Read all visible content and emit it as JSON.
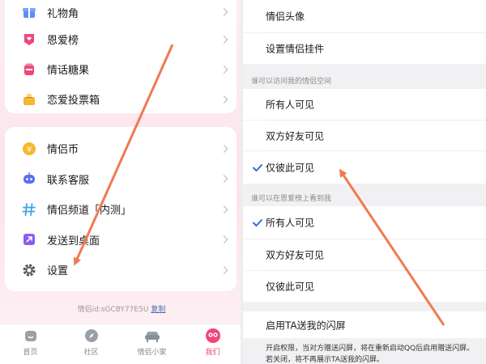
{
  "left": {
    "group1": [
      {
        "label": "礼物角",
        "icon": "gift-icon",
        "color": "#5b8ef0"
      },
      {
        "label": "恩爱榜",
        "icon": "ranking-badge-icon",
        "color": "#f0477a"
      },
      {
        "label": "情话糖果",
        "icon": "candy-jar-icon",
        "color": "#f0477a"
      },
      {
        "label": "恋爱投票箱",
        "icon": "ballot-box-icon",
        "color": "#f5b82e"
      }
    ],
    "group2": [
      {
        "label": "情侣币",
        "icon": "yen-coin-icon",
        "color": "#f5b82e"
      },
      {
        "label": "联系客服",
        "icon": "robot-service-icon",
        "color": "#5b6df0"
      },
      {
        "label": "情侣频道「内测」",
        "icon": "hashtag-icon",
        "color": "#3fa4e6"
      },
      {
        "label": "发送到桌面",
        "icon": "send-to-desktop-icon",
        "color": "#8b5cf0"
      },
      {
        "label": "设置",
        "icon": "gear-icon",
        "color": "#555555"
      }
    ],
    "uid_text": "情侣id:sGCBY77E5U",
    "copy_label": "复制",
    "tabs": [
      {
        "label": "首页",
        "icon": "home-icon"
      },
      {
        "label": "社区",
        "icon": "compass-icon"
      },
      {
        "label": "情侣小家",
        "icon": "sofa-icon"
      },
      {
        "label": "我们",
        "icon": "couple-avatar-icon",
        "active": true
      }
    ],
    "accent": "#f0477a"
  },
  "right": {
    "top_items": [
      "情侣头像",
      "设置情侣挂件"
    ],
    "section1_title": "谁可以访问我的情侣空间",
    "section1_options": [
      {
        "label": "所有人可见",
        "checked": false
      },
      {
        "label": "双方好友可见",
        "checked": false
      },
      {
        "label": "仅彼此可见",
        "checked": true
      }
    ],
    "section2_title": "谁可以在恩爱榜上看到我",
    "section2_options": [
      {
        "label": "所有人可见",
        "checked": true
      },
      {
        "label": "双方好友可见",
        "checked": false
      },
      {
        "label": "仅彼此可见",
        "checked": false
      }
    ],
    "flash_label": "启用TA送我的闪屏",
    "note_line1": "开启权限，当对方赠送闪屏，将在重新启动QQ后启用赠送闪屏。若关闭，将不再展示TA送我的闪屏。",
    "check_color": "#2f6fd6"
  },
  "annotation_color": "#f07a52"
}
